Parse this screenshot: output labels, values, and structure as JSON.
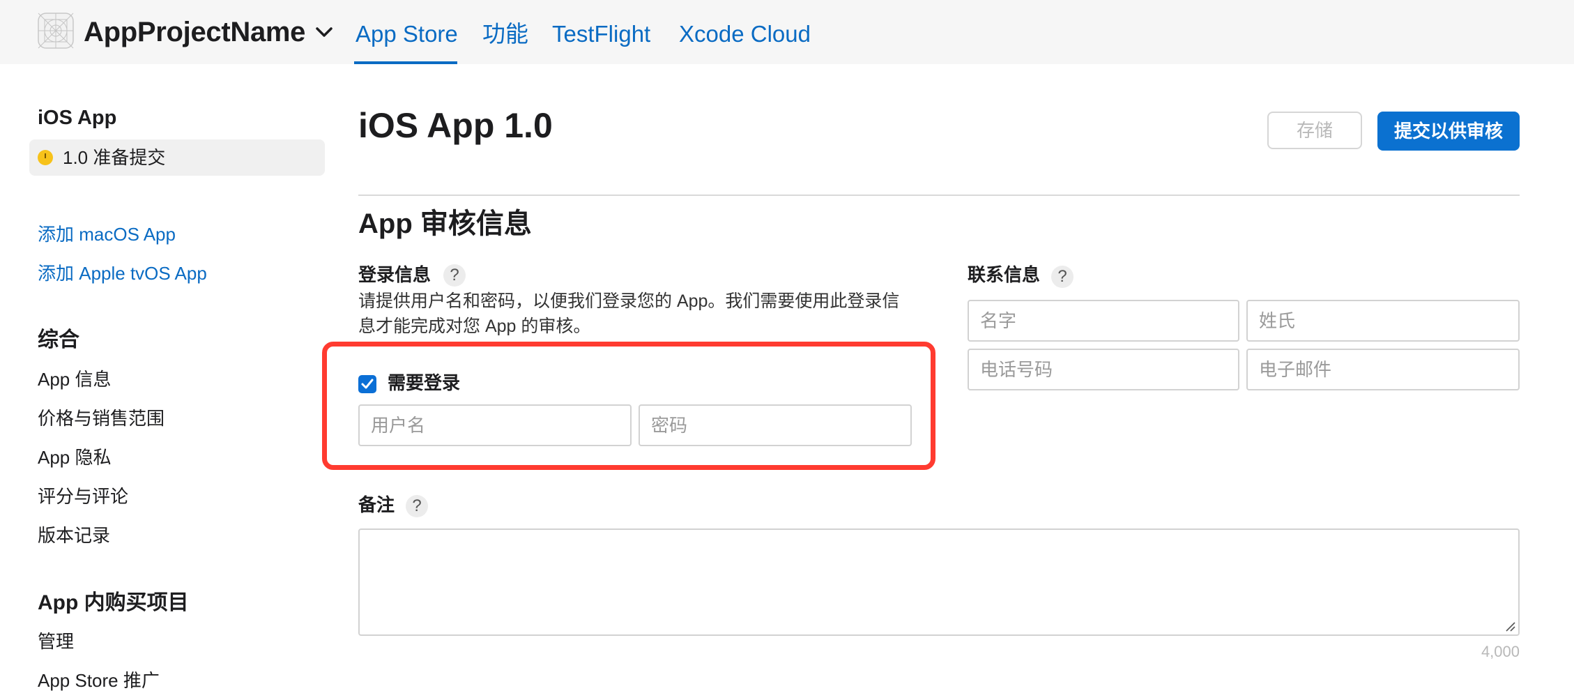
{
  "header": {
    "project_name": "AppProjectName",
    "tabs": [
      {
        "label": "App Store",
        "active": true
      },
      {
        "label": "功能",
        "active": false
      },
      {
        "label": "TestFlight",
        "active": false
      },
      {
        "label": "Xcode Cloud",
        "active": false
      }
    ]
  },
  "sidebar": {
    "platform_title": "iOS App",
    "version_status": "1.0 准备提交",
    "status_color": "#f7c21a",
    "add_links": [
      "添加 macOS App",
      "添加 Apple tvOS App"
    ],
    "general_heading": "综合",
    "general_items": [
      "App 信息",
      "价格与销售范围",
      "App 隐私",
      "评分与评论",
      "版本记录"
    ],
    "iap_heading": "App 内购买项目",
    "iap_items": [
      "管理",
      "App Store 推广"
    ]
  },
  "main": {
    "title": "iOS App 1.0",
    "save_button": "存储",
    "submit_button": "提交以供审核",
    "section_title": "App 审核信息",
    "sign_in": {
      "label": "登录信息",
      "help": "?",
      "description": "请提供用户名和密码，以便我们登录您的 App。我们需要使用此登录信息才能完成对您 App 的审核。",
      "checkbox_label": "需要登录",
      "checkbox_checked": true,
      "username_placeholder": "用户名",
      "password_placeholder": "密码"
    },
    "contact": {
      "label": "联系信息",
      "help": "?",
      "first_name_placeholder": "名字",
      "last_name_placeholder": "姓氏",
      "phone_placeholder": "电话号码",
      "email_placeholder": "电子邮件"
    },
    "notes": {
      "label": "备注",
      "help": "?",
      "char_limit": "4,000"
    }
  },
  "colors": {
    "accent": "#0a6bc3",
    "highlight_border": "#ff3b30"
  }
}
